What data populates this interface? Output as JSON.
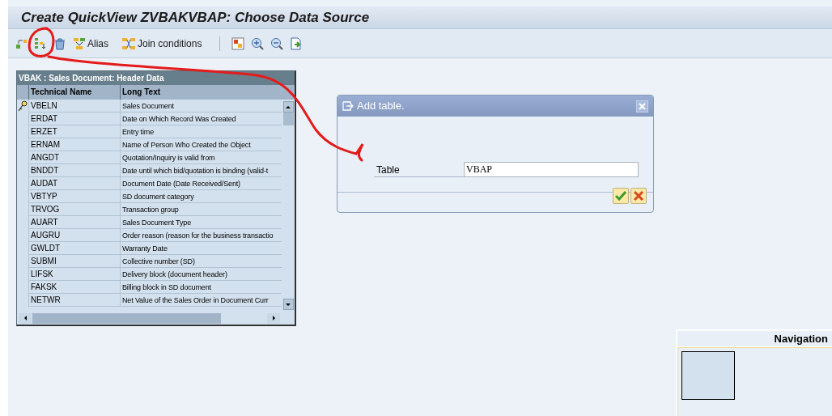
{
  "window": {
    "title": "Create QuickView ZVBAKVBAP: Choose Data Source"
  },
  "toolbar": [
    {
      "kind": "create"
    },
    {
      "kind": "insert"
    },
    {
      "kind": "delete"
    },
    {
      "kind": "alias",
      "label": "Alias"
    },
    {
      "kind": "join",
      "label": "Join conditions"
    },
    {
      "kind": "separator"
    },
    {
      "kind": "layout"
    },
    {
      "kind": "zoom_in"
    },
    {
      "kind": "zoom_out"
    },
    {
      "kind": "export"
    }
  ],
  "table": {
    "title": "VBAK : Sales Document: Header Data",
    "columns": [
      "Technical Name",
      "Long Text"
    ],
    "rows": [
      {
        "name": "VBELN",
        "text": "Sales Document",
        "key": true
      },
      {
        "name": "ERDAT",
        "text": "Date on Which Record Was Created",
        "key": false
      },
      {
        "name": "ERZET",
        "text": "Entry time",
        "key": false
      },
      {
        "name": "ERNAM",
        "text": "Name of Person Who Created the Object",
        "key": false
      },
      {
        "name": "ANGDT",
        "text": "Quotation/Inquiry is valid from",
        "key": false
      },
      {
        "name": "BNDDT",
        "text": "Date until which bid/quotation is binding (valid-t",
        "key": false
      },
      {
        "name": "AUDAT",
        "text": "Document Date (Date Received/Sent)",
        "key": false
      },
      {
        "name": "VBTYP",
        "text": "SD document category",
        "key": false
      },
      {
        "name": "TRVOG",
        "text": "Transaction group",
        "key": false
      },
      {
        "name": "AUART",
        "text": "Sales Document Type",
        "key": false
      },
      {
        "name": "AUGRU",
        "text": "Order reason (reason for the business transactio",
        "key": false
      },
      {
        "name": "GWLDT",
        "text": "Warranty Date",
        "key": false
      },
      {
        "name": "SUBMI",
        "text": "Collective number (SD)",
        "key": false
      },
      {
        "name": "LIFSK",
        "text": "Delivery block (document header)",
        "key": false
      },
      {
        "name": "FAKSK",
        "text": "Billing block in SD document",
        "key": false
      },
      {
        "name": "NETWR",
        "text": "Net Value of the Sales Order in Document Curr",
        "key": false
      }
    ]
  },
  "dialog": {
    "title": "Add table.",
    "field_label": "Table",
    "field_value": "VBAP"
  },
  "navigation": {
    "title": "Navigation"
  }
}
